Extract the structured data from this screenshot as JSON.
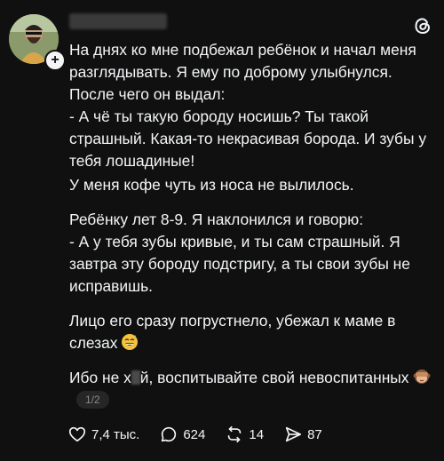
{
  "post": {
    "username": "",
    "paragraphs": [
      "На днях ко мне подбежал ребёнок и начал меня разглядывать. Я ему по доброму улыбнулся. После чего он выдал:\n- А чё ты такую бороду носишь? Ты такой страшный. Какая-то некрасивая борода. И зубы у тебя лошадиные!",
      "У меня кофе чуть из носа не вылилось.",
      "Ребёнку лет 8-9. Я наклонился и говорю:\n- А у тебя зубы кривые, и ты сам страшный. Я завтра эту бороду подстригу, а ты свои зубы не исправишь.",
      "Лицо его сразу погрустнело, убежал к маме в слезах"
    ],
    "last_paragraph": {
      "part1": "Ибо не х",
      "part2": "й, воспитывайте свой невоспитанных"
    },
    "page_indicator": "1/2"
  },
  "actions": {
    "likes": "7,4 тыс.",
    "comments": "624",
    "reposts": "14",
    "shares": "87"
  },
  "icons": {
    "like": "heart-icon",
    "comment": "comment-bubble-icon",
    "repost": "repost-icon",
    "share": "send-icon",
    "threads": "threads-logo-icon"
  }
}
